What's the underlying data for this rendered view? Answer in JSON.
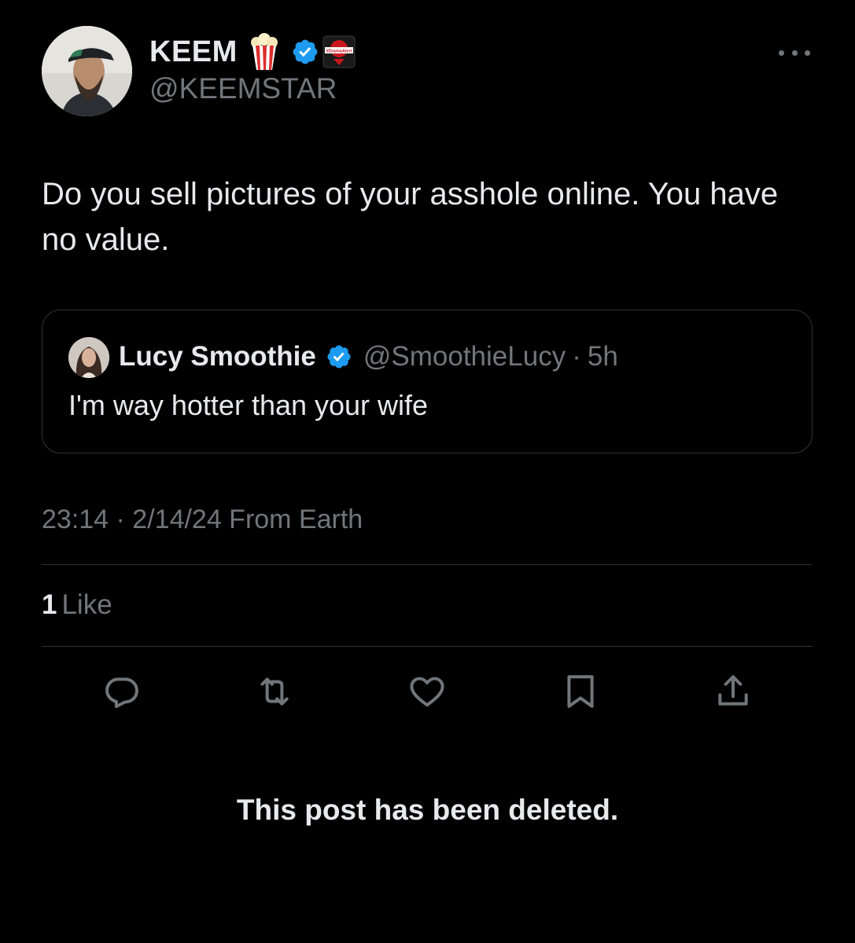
{
  "author": {
    "display_name": "KEEM",
    "handle": "@KEEMSTAR",
    "badge_emoji_icon": "popcorn-icon",
    "verified_color": "#1d9bf0",
    "affiliate_badge_text": "#DramaAlert"
  },
  "tweet": {
    "text": "Do you sell pictures of your asshole online. You have no value.",
    "timestamp": "23:14 · 2/14/24 From Earth"
  },
  "quote": {
    "display_name": "Lucy Smoothie",
    "handle": "@SmoothieLucy",
    "separator": "·",
    "time": "5h",
    "text": "I'm way hotter than your wife"
  },
  "stats": {
    "likes_count": "1",
    "likes_label": "Like"
  },
  "actions": [
    {
      "name": "reply",
      "icon": "reply-icon"
    },
    {
      "name": "retweet",
      "icon": "retweet-icon"
    },
    {
      "name": "like",
      "icon": "heart-icon"
    },
    {
      "name": "bookmark",
      "icon": "bookmark-icon"
    },
    {
      "name": "share",
      "icon": "share-icon"
    }
  ],
  "notice": "This post has been deleted.",
  "colors": {
    "background": "#000000",
    "text_primary": "#e7e9ea",
    "text_secondary": "#71767b",
    "border": "#2f3336",
    "verified": "#1d9bf0"
  }
}
